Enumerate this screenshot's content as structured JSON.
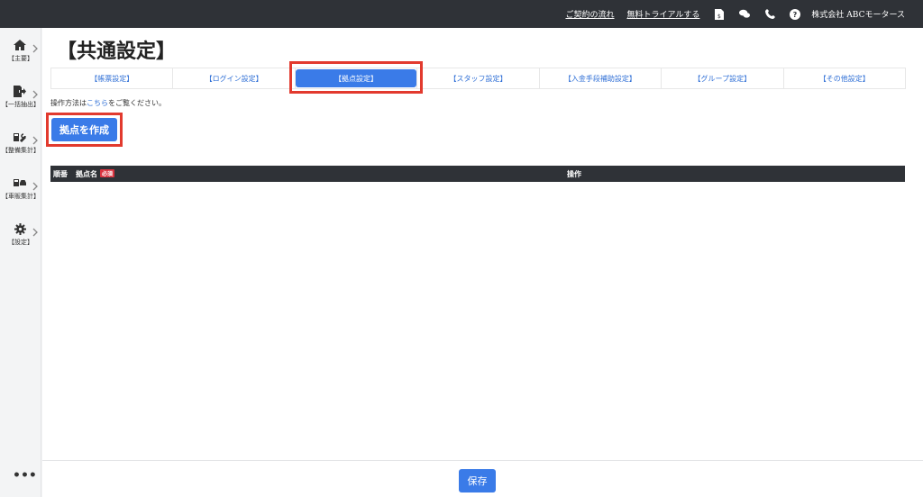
{
  "topbar": {
    "links": [
      "ご契約の流れ",
      "無料トライアルする"
    ],
    "icons": [
      "document-yen-icon",
      "chat-icon",
      "phone-icon",
      "help-icon"
    ],
    "company": "株式会社 ABCモータース"
  },
  "sidebar": {
    "items": [
      {
        "icon": "home-icon",
        "label": "【主要】"
      },
      {
        "icon": "export-icon",
        "label": "【一括抽出】"
      },
      {
        "icon": "maintenance-icon",
        "label": "【整備集計】"
      },
      {
        "icon": "car-sales-icon",
        "label": "【車販集計】"
      },
      {
        "icon": "gear-icon",
        "label": "【設定】"
      }
    ],
    "more": "•••"
  },
  "page": {
    "title": "【共通設定】",
    "tabs": [
      {
        "label": "【帳票設定】"
      },
      {
        "label": "【ログイン設定】"
      },
      {
        "label": "【拠点設定】",
        "active": true
      },
      {
        "label": "【スタッフ設定】"
      },
      {
        "label": "【入金手段補助設定】"
      },
      {
        "label": "【グループ設定】"
      },
      {
        "label": "【その他設定】"
      }
    ],
    "help_prefix": "操作方法は",
    "help_link": "こちら",
    "help_suffix": "をご覧ください。",
    "create_button": "拠点を作成",
    "table": {
      "col_order": "順番",
      "col_name": "拠点名",
      "required": "必須",
      "col_action": "操作"
    },
    "save_button": "保存"
  },
  "colors": {
    "accent": "#3a7be8",
    "highlight": "#e23a2e",
    "topbar": "#2f3237"
  }
}
